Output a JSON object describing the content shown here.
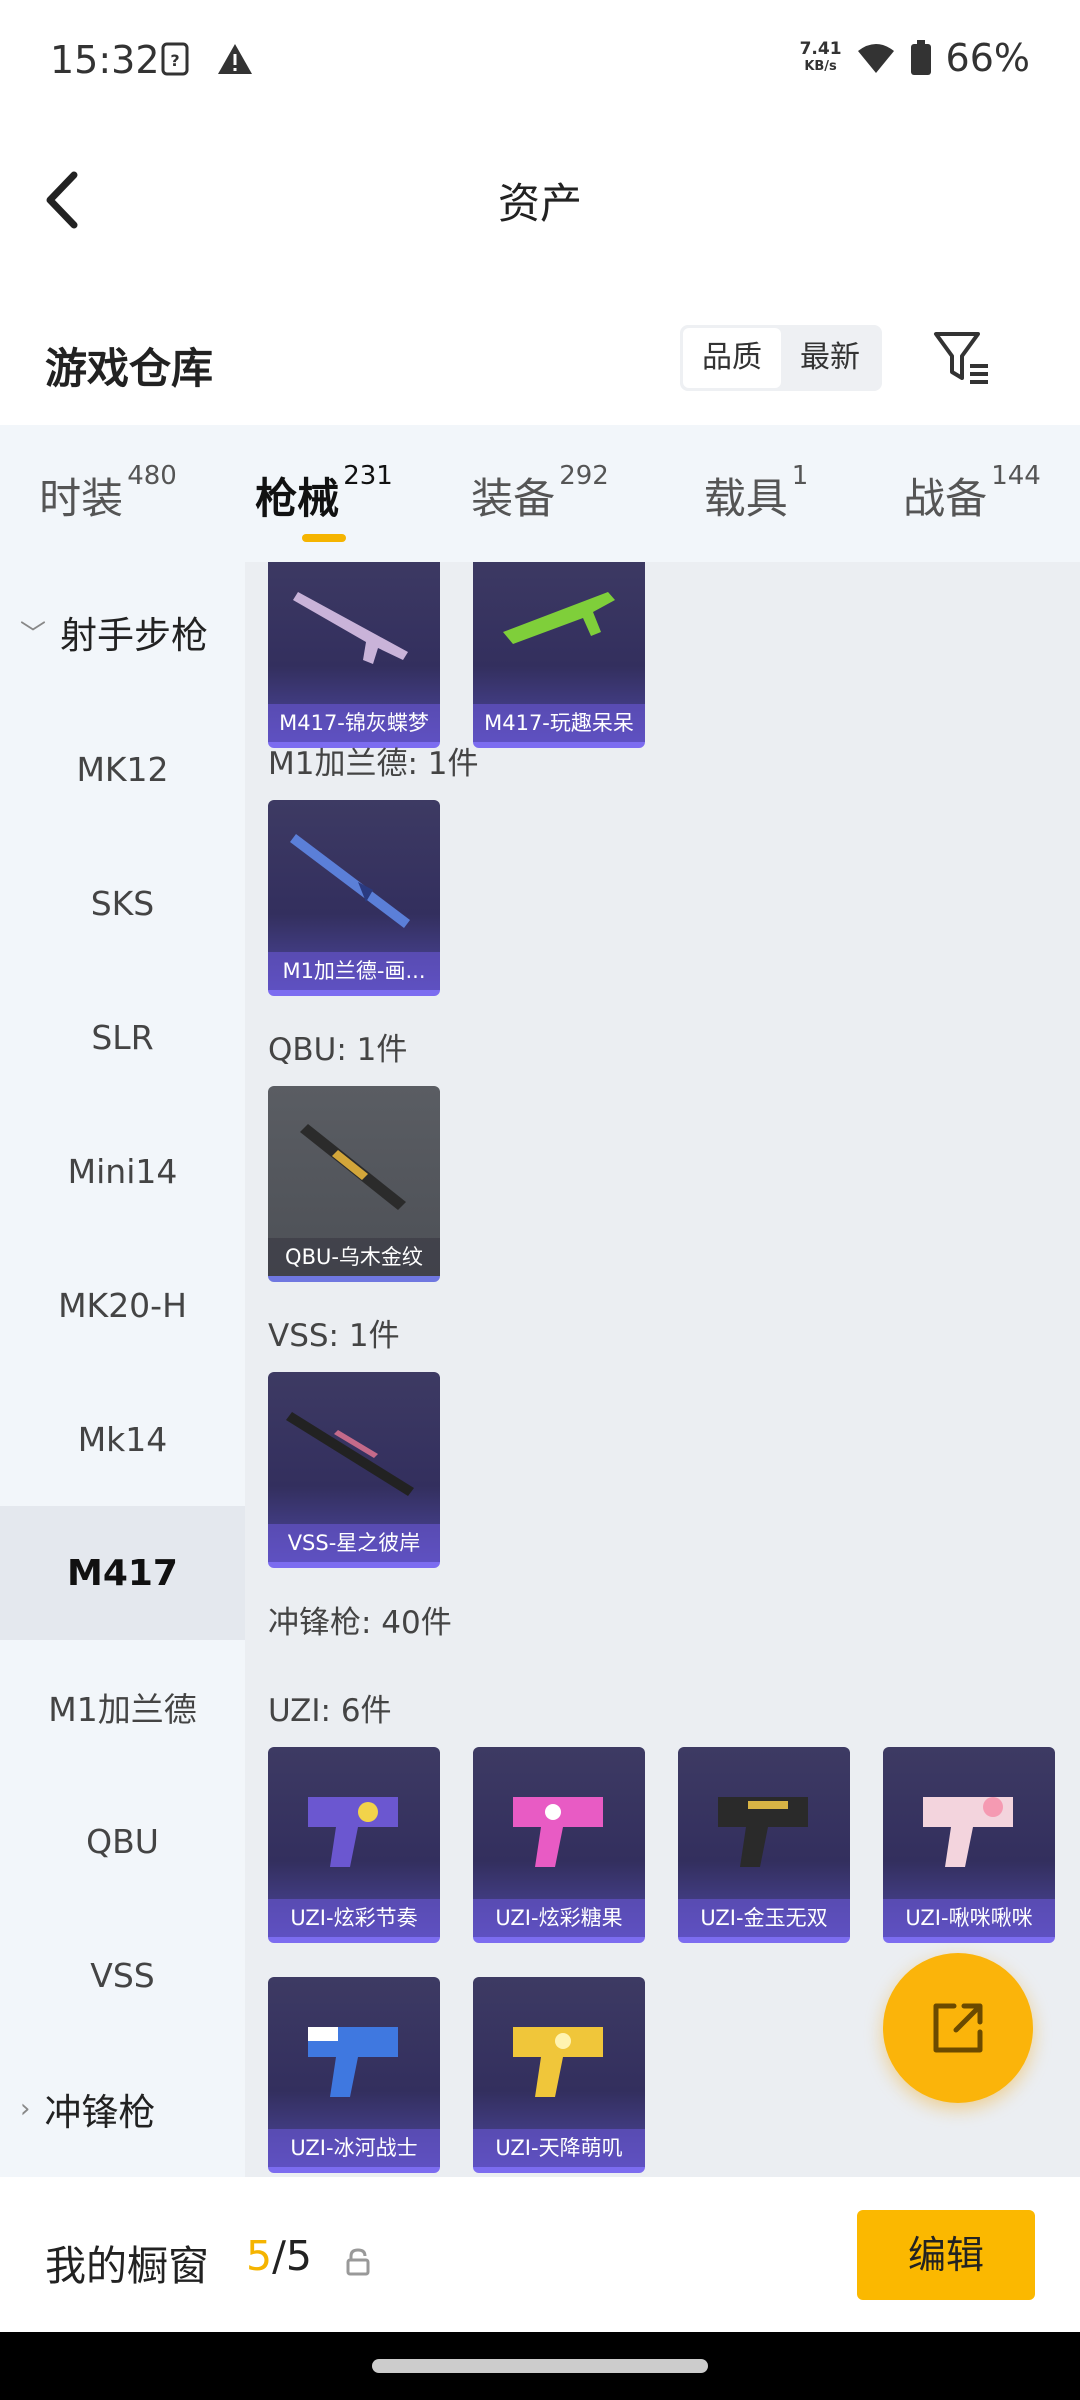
{
  "status_bar": {
    "time": "15:32",
    "net_speed_value": "7.41",
    "net_speed_unit": "KB/s",
    "battery": "66%"
  },
  "header": {
    "title": "资产"
  },
  "warehouse": {
    "title": "游戏仓库",
    "sort_quality": "品质",
    "sort_newest": "最新"
  },
  "tabs": [
    {
      "label": "时装",
      "count": "480"
    },
    {
      "label": "枪械",
      "count": "231"
    },
    {
      "label": "装备",
      "count": "292"
    },
    {
      "label": "载具",
      "count": "1"
    },
    {
      "label": "战备",
      "count": "144"
    }
  ],
  "sidebar": {
    "group_rifle": "射手步枪",
    "items": [
      "MK12",
      "SKS",
      "SLR",
      "Mini14",
      "MK20-H",
      "Mk14",
      "M417",
      "M1加兰德",
      "QBU",
      "VSS"
    ],
    "group_smg": "冲锋枪"
  },
  "content": {
    "top_cards": [
      "M417-锦灰蝶梦",
      "M417-玩趣呆呆"
    ],
    "m1_label": "M1加兰德: 1件",
    "m1_cards": [
      "M1加兰德-画..."
    ],
    "qbu_label": "QBU: 1件",
    "qbu_cards": [
      "QBU-乌木金纹"
    ],
    "vss_label": "VSS: 1件",
    "vss_cards": [
      "VSS-星之彼岸"
    ],
    "smg_label": "冲锋枪: 40件",
    "uzi_label": "UZI: 6件",
    "uzi_cards": [
      "UZI-炫彩节奏",
      "UZI-炫彩糖果",
      "UZI-金玉无双",
      "UZI-啾咪啾咪",
      "UZI-冰河战士",
      "UZI-天降萌叽"
    ]
  },
  "bottom": {
    "label": "我的橱窗",
    "count_current": "5",
    "count_sep_total": "/5",
    "edit_label": "编辑"
  },
  "colors": {
    "accent": "#fbb800",
    "card_purple": "#3d3a63",
    "underline": "#f5b400"
  }
}
